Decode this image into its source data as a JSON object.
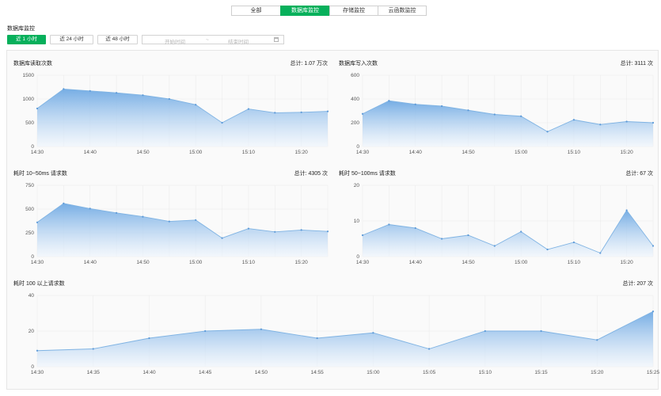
{
  "tabs": [
    "全部",
    "数据库监控",
    "存储监控",
    "云函数监控"
  ],
  "active_tab": 1,
  "section_title": "数据库监控",
  "time_ranges": [
    "近 1 小时",
    "近 24 小时",
    "近 48 小时"
  ],
  "active_range": 0,
  "date_picker": {
    "start_placeholder": "开始时间",
    "separator": "~",
    "end_placeholder": "结束时间"
  },
  "colors": {
    "accent": "#07b05b",
    "line": "#7fb3e3",
    "area_top": "#6fa9e3",
    "area_bottom": "#eef5fd"
  },
  "chart_data": [
    {
      "type": "area",
      "title": "数据库读取次数",
      "total_label": "总计: 1.07 万次",
      "x": [
        "14:30",
        "14:35",
        "14:40",
        "14:45",
        "14:50",
        "14:55",
        "15:00",
        "15:05",
        "15:10",
        "15:15",
        "15:20",
        "15:25"
      ],
      "x_ticks": [
        "14:30",
        "14:40",
        "14:50",
        "15:00",
        "15:10",
        "15:20"
      ],
      "y_ticks": [
        0,
        500,
        1000,
        1500
      ],
      "ylim": [
        0,
        1500
      ],
      "values": [
        800,
        1210,
        1170,
        1130,
        1080,
        1000,
        880,
        500,
        790,
        710,
        720,
        740
      ]
    },
    {
      "type": "area",
      "title": "数据库写入次数",
      "total_label": "总计: 3111 次",
      "x": [
        "14:30",
        "14:35",
        "14:40",
        "14:45",
        "14:50",
        "14:55",
        "15:00",
        "15:05",
        "15:10",
        "15:15",
        "15:20",
        "15:25"
      ],
      "x_ticks": [
        "14:30",
        "14:40",
        "14:50",
        "15:00",
        "15:10",
        "15:20"
      ],
      "y_ticks": [
        0,
        200,
        400,
        600
      ],
      "ylim": [
        0,
        600
      ],
      "values": [
        275,
        385,
        355,
        340,
        305,
        270,
        255,
        125,
        225,
        185,
        210,
        200
      ]
    },
    {
      "type": "area",
      "title": "耗时 10~50ms 请求数",
      "total_label": "总计: 4305 次",
      "x": [
        "14:30",
        "14:35",
        "14:40",
        "14:45",
        "14:50",
        "14:55",
        "15:00",
        "15:05",
        "15:10",
        "15:15",
        "15:20",
        "15:25"
      ],
      "x_ticks": [
        "14:30",
        "14:40",
        "14:50",
        "15:00",
        "15:10",
        "15:20"
      ],
      "y_ticks": [
        0,
        250,
        500,
        750
      ],
      "ylim": [
        0,
        750
      ],
      "values": [
        360,
        560,
        505,
        460,
        420,
        370,
        385,
        195,
        295,
        260,
        280,
        265
      ]
    },
    {
      "type": "area",
      "title": "耗时 50~100ms 请求数",
      "total_label": "总计: 67 次",
      "x": [
        "14:30",
        "14:35",
        "14:40",
        "14:45",
        "14:50",
        "14:55",
        "15:00",
        "15:05",
        "15:10",
        "15:15",
        "15:20",
        "15:25"
      ],
      "x_ticks": [
        "14:30",
        "14:40",
        "14:50",
        "15:00",
        "15:10",
        "15:20"
      ],
      "y_ticks": [
        0,
        10,
        20
      ],
      "ylim": [
        0,
        20
      ],
      "values": [
        6,
        9,
        8,
        5,
        6,
        3,
        7,
        2,
        4,
        1,
        13,
        3
      ]
    },
    {
      "type": "area",
      "title": "耗时 100 以上请求数",
      "total_label": "总计: 207 次",
      "x": [
        "14:30",
        "14:35",
        "14:40",
        "14:45",
        "14:50",
        "14:55",
        "15:00",
        "15:05",
        "15:10",
        "15:15",
        "15:20",
        "15:25"
      ],
      "x_ticks": [
        "14:30",
        "14:35",
        "14:40",
        "14:45",
        "14:50",
        "14:55",
        "15:00",
        "15:05",
        "15:10",
        "15:15",
        "15:20",
        "15:25"
      ],
      "y_ticks": [
        0,
        20,
        40
      ],
      "ylim": [
        0,
        40
      ],
      "values": [
        9,
        10,
        16,
        20,
        21,
        16,
        19,
        10,
        20,
        20,
        15,
        31
      ]
    }
  ]
}
